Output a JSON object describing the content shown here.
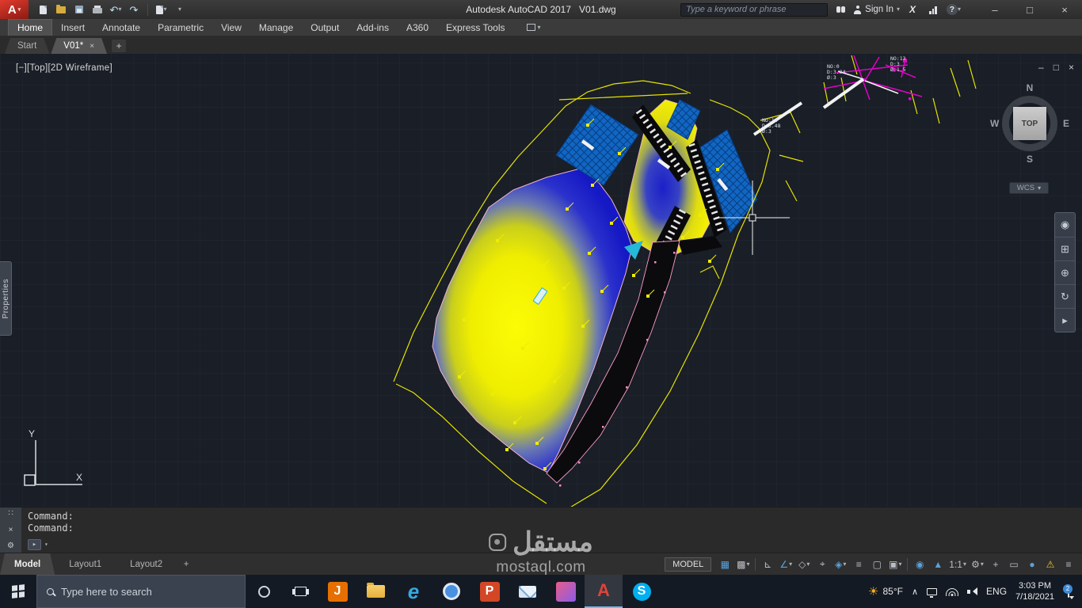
{
  "title_bar": {
    "app": "Autodesk AutoCAD 2017",
    "doc": "V01.dwg",
    "search_placeholder": "Type a keyword or phrase",
    "sign_in_label": "Sign In"
  },
  "ribbon": {
    "tabs": [
      "Home",
      "Insert",
      "Annotate",
      "Parametric",
      "View",
      "Manage",
      "Output",
      "Add-ins",
      "A360",
      "Express Tools"
    ]
  },
  "file_tabs": {
    "start": "Start",
    "doc": "V01*"
  },
  "canvas": {
    "viewport_label": "[−][Top][2D Wireframe]",
    "viewcube": {
      "n": "N",
      "s": "S",
      "e": "E",
      "w": "W",
      "face": "TOP",
      "wcs": "WCS"
    },
    "properties_tab": "Properties",
    "ucs": {
      "x": "X",
      "y": "Y"
    },
    "survey_labels": [
      {
        "a": "NO:18",
        "b": "D:3.48",
        "c": "Ø:3"
      },
      {
        "a": "NO:0",
        "b": "D:3.84",
        "c": "Ø:3"
      },
      {
        "a": "NO:13",
        "b": "D:3",
        "c": "Ø:1.5"
      }
    ]
  },
  "command": {
    "line1": "Command:",
    "line2": "Command:"
  },
  "layouts": {
    "model": "Model",
    "layout1": "Layout1",
    "layout2": "Layout2"
  },
  "status": {
    "model": "MODEL",
    "scale": "1:1"
  },
  "watermark": {
    "name": "مستقل",
    "site": "mostaql.com"
  },
  "taskbar": {
    "search_placeholder": "Type here to search",
    "temp": "85°F",
    "lang": "ENG",
    "time": "3:03 PM",
    "date": "7/18/2021",
    "badge": "2"
  },
  "icons": {
    "caret": "▾",
    "close": "×",
    "minimize": "–",
    "maximize": "□",
    "plus": "+",
    "undo": "↶",
    "redo": "↷",
    "help": "?",
    "gear": "⚙",
    "grid": "▦",
    "snap": "▩",
    "ortho": "⊾",
    "polar": "∠",
    "iso": "◇",
    "osnap": "◈",
    "tracking": "⌖",
    "lineweight": "≡",
    "transparency": "▢",
    "cycling": "▣",
    "annot": "◉",
    "annot2": "▲",
    "isolate": "▭",
    "perf": "●",
    "warn": "⚠",
    "burger": "≡",
    "wheel": "◉",
    "pan": "⊞",
    "zoom": "⊕",
    "orbit": "↻",
    "more": "▸",
    "sun": "☀",
    "chevron": "∧",
    "grip": "∷",
    "x_letter": "X",
    "edge": "e",
    "ppt": "P",
    "skype": "S",
    "java": "J",
    "autocad_a": "A",
    "logo_a": "A"
  },
  "colors": {
    "heat_yellow": "#f4f000",
    "heat_blue": "#1c1fc9",
    "hatch_blue": "#1068c2",
    "boundary_yellow": "#e6e200",
    "magenta": "#e400c8",
    "accent_red": "#c4281e"
  }
}
